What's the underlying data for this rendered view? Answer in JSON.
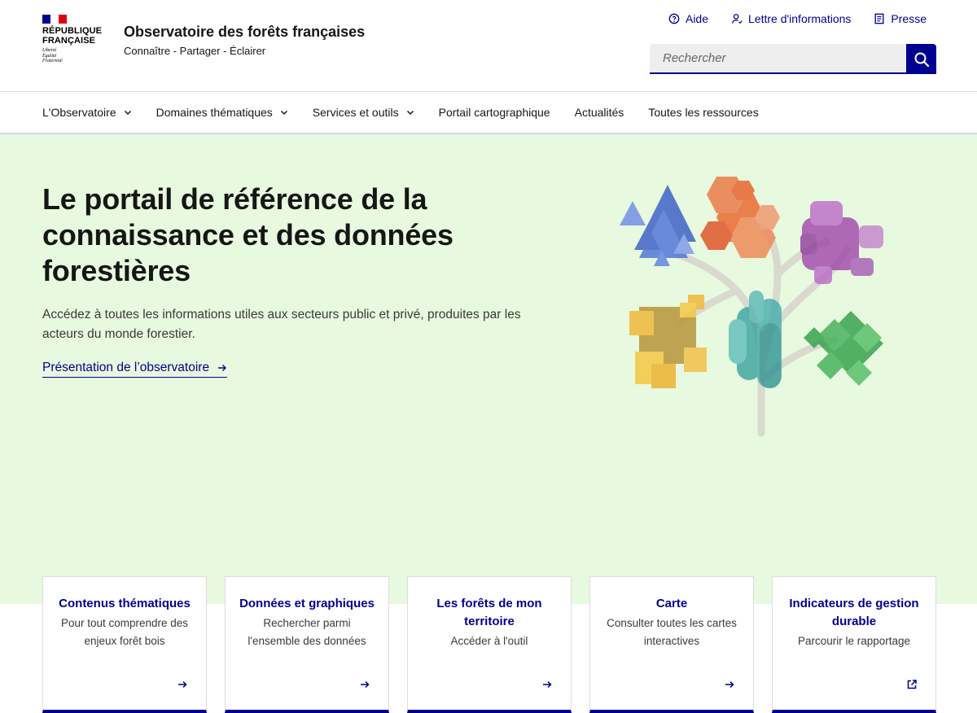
{
  "header": {
    "rf_name_line1": "RÉPUBLIQUE",
    "rf_name_line2": "FRANÇAISE",
    "rf_motto_1": "Liberté",
    "rf_motto_2": "Égalité",
    "rf_motto_3": "Fraternité",
    "site_title": "Observatoire des forêts françaises",
    "site_tagline": "Connaître - Partager - Éclairer",
    "quick_links": [
      {
        "label": "Aide",
        "icon": "help-circle-icon"
      },
      {
        "label": "Lettre d'informations",
        "icon": "user-icon"
      },
      {
        "label": "Presse",
        "icon": "article-icon"
      }
    ],
    "search": {
      "placeholder": "Rechercher",
      "icon": "search-icon"
    }
  },
  "nav": {
    "items": [
      {
        "label": "L'Observatoire",
        "has_dropdown": true
      },
      {
        "label": "Domaines thématiques",
        "has_dropdown": true
      },
      {
        "label": "Services et outils",
        "has_dropdown": true
      },
      {
        "label": "Portail cartographique",
        "has_dropdown": false
      },
      {
        "label": "Actualités",
        "has_dropdown": false
      },
      {
        "label": "Toutes les ressources",
        "has_dropdown": false
      }
    ]
  },
  "hero": {
    "title": "Le portail de référence de la connaissance et des données forestières",
    "description": "Accédez à toutes les informations utiles aux secteurs public et privé, produites par les acteurs du monde forestier.",
    "link_label": "Présentation de l’observatoire"
  },
  "cards": [
    {
      "title": "Contenus thématiques",
      "description": "Pour tout comprendre des enjeux forêt bois",
      "icon": "arrow-right-icon"
    },
    {
      "title": "Données et graphiques",
      "description": "Rechercher parmi l'ensemble des données",
      "icon": "arrow-right-icon"
    },
    {
      "title": "Les forêts de mon territoire",
      "description": "Accéder à l'outil",
      "icon": "arrow-right-icon"
    },
    {
      "title": "Carte",
      "description": "Consulter toutes les cartes interactives",
      "icon": "arrow-right-icon"
    },
    {
      "title": "Indicateurs de gestion durable",
      "description": "Parcourir le rapportage",
      "icon": "external-link-icon"
    }
  ],
  "colors": {
    "brand_blue": "#000091",
    "hero_background": "#e7f9de",
    "flag_blue": "#000091",
    "flag_red": "#e1000f"
  }
}
